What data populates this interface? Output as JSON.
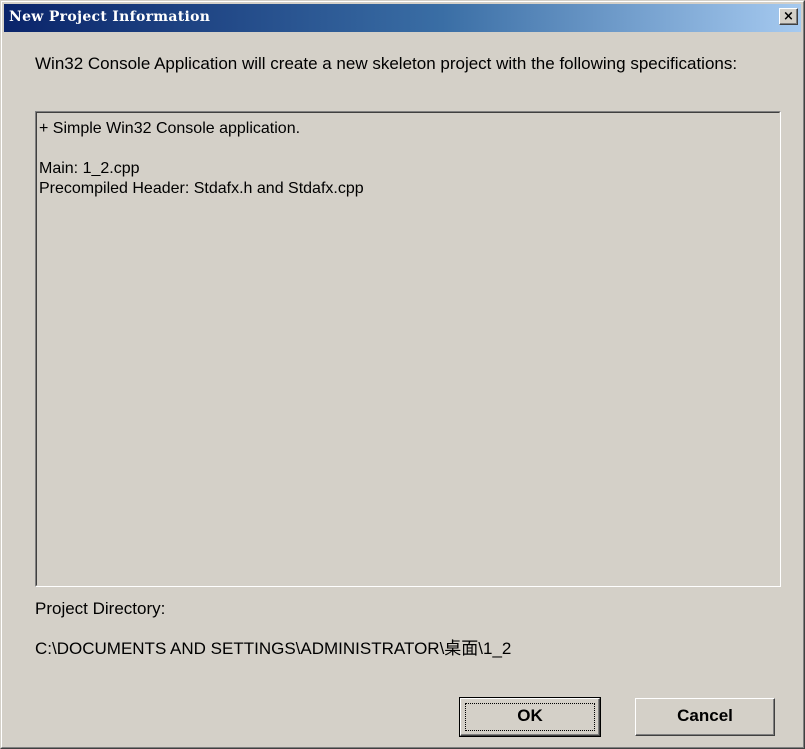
{
  "window": {
    "title": "New Project Information",
    "close_glyph": "×"
  },
  "intro_text": "Win32 Console Application will create a new skeleton project with the following specifications:",
  "specifications": [
    "+ Simple Win32 Console application.",
    "",
    "Main: 1_2.cpp",
    "Precompiled Header: Stdafx.h and Stdafx.cpp"
  ],
  "project_directory": {
    "label": "Project Directory:",
    "path": "C:\\DOCUMENTS AND SETTINGS\\ADMINISTRATOR\\桌面\\1_2"
  },
  "buttons": {
    "ok": "OK",
    "cancel": "Cancel"
  },
  "colors": {
    "face": "#d4d0c8",
    "title_start": "#0a246a",
    "title_end": "#a6caf0"
  },
  "icons": {
    "close": "close-icon"
  }
}
